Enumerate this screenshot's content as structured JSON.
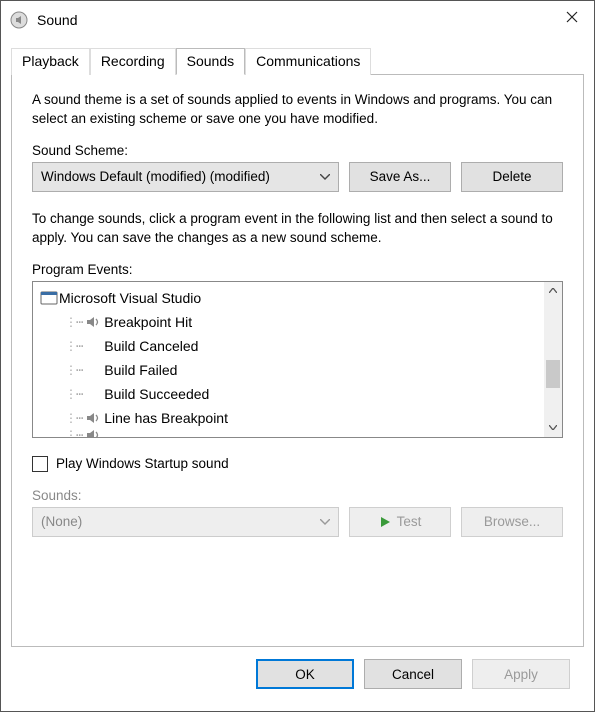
{
  "title": "Sound",
  "tabs": [
    "Playback",
    "Recording",
    "Sounds",
    "Communications"
  ],
  "active_tab_index": 2,
  "panel": {
    "desc": "A sound theme is a set of sounds applied to events in Windows and programs.  You can select an existing scheme or save one you have modified.",
    "scheme_label": "Sound Scheme:",
    "scheme_value": "Windows Default (modified) (modified)",
    "save_as_label": "Save As...",
    "delete_label": "Delete",
    "desc2": "To change sounds, click a program event in the following list and then select a sound to apply.  You can save the changes as a new sound scheme.",
    "events_label": "Program Events:",
    "events": [
      {
        "label": "Microsoft Visual Studio",
        "icon": "app",
        "indent": 0
      },
      {
        "label": "Breakpoint Hit",
        "icon": "sound",
        "indent": 1
      },
      {
        "label": "Build Canceled",
        "icon": "none",
        "indent": 1
      },
      {
        "label": "Build Failed",
        "icon": "none",
        "indent": 1
      },
      {
        "label": "Build Succeeded",
        "icon": "none",
        "indent": 1
      },
      {
        "label": "Line has Breakpoint",
        "icon": "sound",
        "indent": 1
      }
    ],
    "startup_label": "Play Windows Startup sound",
    "startup_checked": false,
    "sounds_section_label": "Sounds:",
    "sounds_value": "(None)",
    "test_label": "Test",
    "browse_label": "Browse..."
  },
  "footer": {
    "ok": "OK",
    "cancel": "Cancel",
    "apply": "Apply"
  }
}
